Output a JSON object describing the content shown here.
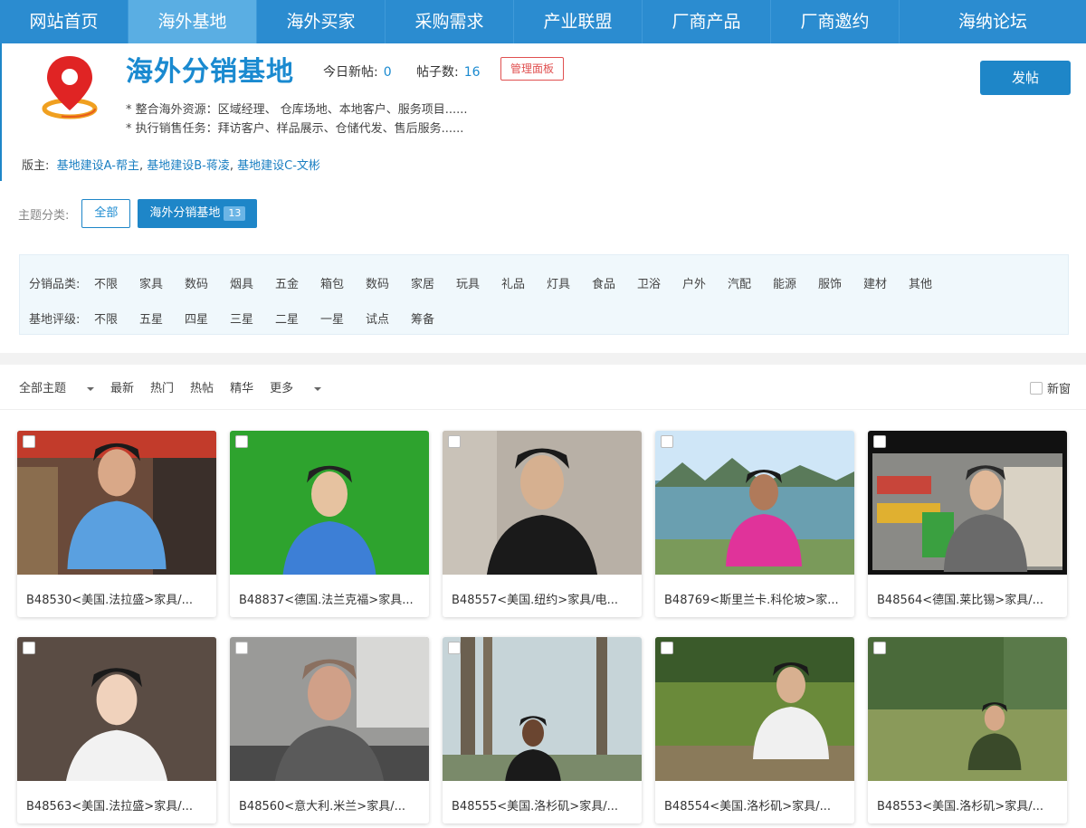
{
  "nav": {
    "items": [
      "网站首页",
      "海外基地",
      "海外买家",
      "采购需求",
      "产业联盟",
      "厂商产品",
      "厂商邀约",
      "海纳论坛"
    ],
    "active_index": 1
  },
  "header": {
    "title": "海外分销基地",
    "today_label": "今日新帖:",
    "today_value": "0",
    "posts_label": "帖子数:",
    "posts_value": "16",
    "manage_label": "管理面板",
    "post_button": "发帖",
    "desc_line1": "* 整合海外资源：区域经理、 仓库场地、本地客户、服务项目......",
    "desc_line2": "* 执行销售任务：拜访客户、样品展示、仓储代发、售后服务......",
    "moderators_label": "版主:",
    "moderators": [
      "基地建设A-帮主",
      "基地建设B-蒋凌",
      "基地建设C-文彬"
    ]
  },
  "topics": {
    "label": "主题分类:",
    "all_label": "全部",
    "active_label": "海外分销基地",
    "active_count": "13"
  },
  "filters": {
    "category_label": "分销品类:",
    "categories": [
      "不限",
      "家具",
      "数码",
      "烟具",
      "五金",
      "箱包",
      "数码",
      "家居",
      "玩具",
      "礼品",
      "灯具",
      "食品",
      "卫浴",
      "户外",
      "汽配",
      "能源",
      "服饰",
      "建材",
      "其他"
    ],
    "rating_label": "基地评级:",
    "ratings": [
      "不限",
      "五星",
      "四星",
      "三星",
      "二星",
      "一星",
      "试点",
      "筹备"
    ]
  },
  "sortbar": {
    "items": [
      "全部主题",
      "最新",
      "热门",
      "热帖",
      "精华",
      "更多"
    ],
    "new_window_label": "新窗"
  },
  "colors": {
    "primary": "#1e86c8",
    "nav_bg": "#2b8cd0",
    "nav_active": "#5aaee3",
    "manage_red": "#e05050"
  },
  "posts": [
    {
      "caption": "B48530<美国.法拉盛>家具/...",
      "scene": "street-shop"
    },
    {
      "caption": "B48837<德国.法兰克福>家具...",
      "scene": "green-screen"
    },
    {
      "caption": "B48557<美国.纽约>家具/电...",
      "scene": "indoor-portrait"
    },
    {
      "caption": "B48769<斯里兰卡.科伦坡>家...",
      "scene": "lakeside"
    },
    {
      "caption": "B48564<德国.莱比锡>家具/...",
      "scene": "supermarket"
    },
    {
      "caption": "B48563<美国.法拉盛>家具/...",
      "scene": "portrait"
    },
    {
      "caption": "B48560<意大利.米兰>家具/...",
      "scene": "office"
    },
    {
      "caption": "B48555<美国.洛杉矶>家具/...",
      "scene": "palm-trees"
    },
    {
      "caption": "B48554<美国.洛杉矶>家具/...",
      "scene": "park-sitting"
    },
    {
      "caption": "B48553<美国.洛杉矶>家具/...",
      "scene": "park-garden"
    }
  ]
}
